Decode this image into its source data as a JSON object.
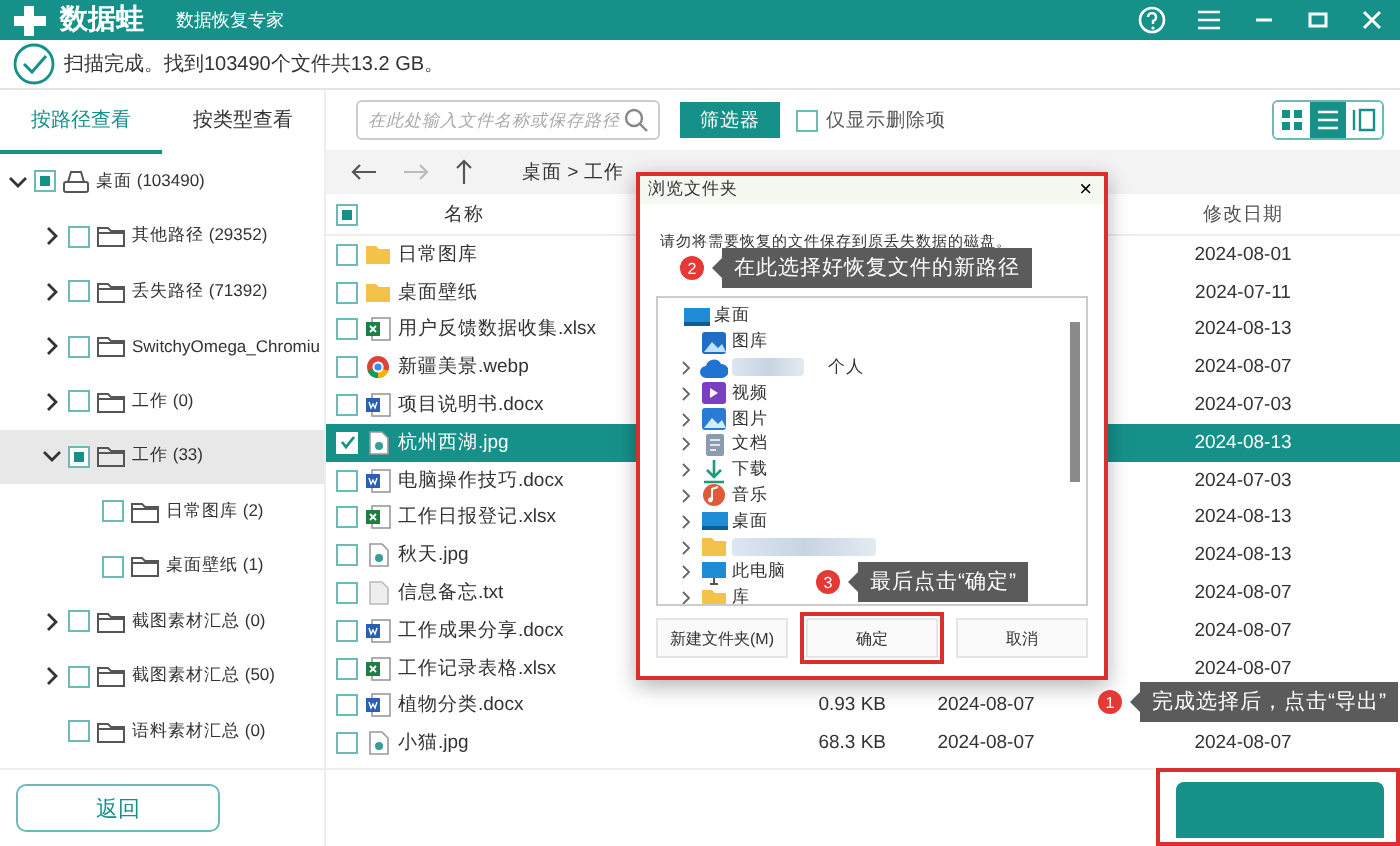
{
  "app": {
    "name": "数据蛙",
    "subtitle": "数据恢复专家"
  },
  "status": "扫描完成。找到103490个文件共13.2 GB。",
  "tabs": [
    {
      "label": "按路径查看",
      "selected": true
    },
    {
      "label": "按类型查看",
      "selected": false
    }
  ],
  "tree": [
    {
      "label": "桌面 (103490)",
      "expandable": true,
      "expanded": true,
      "partial": true,
      "selected": false,
      "kind": "drive",
      "children": [
        {
          "label": "其他路径 (29352)",
          "expandable": true,
          "expanded": false,
          "partial": false,
          "selected": false,
          "kind": "folder"
        },
        {
          "label": "丢失路径 (71392)",
          "expandable": true,
          "expanded": false,
          "partial": false,
          "selected": false,
          "kind": "folder"
        },
        {
          "label": "SwitchyOmega_Chromiu",
          "expandable": true,
          "expanded": false,
          "partial": false,
          "selected": false,
          "kind": "folder"
        },
        {
          "label": "工作 (0)",
          "expandable": true,
          "expanded": false,
          "partial": false,
          "selected": false,
          "kind": "folder"
        },
        {
          "label": "工作 (33)",
          "expandable": true,
          "expanded": true,
          "partial": true,
          "selected": true,
          "kind": "folder",
          "children": [
            {
              "label": "日常图库 (2)",
              "expandable": false,
              "partial": false,
              "selected": false,
              "kind": "folder"
            },
            {
              "label": "桌面壁纸 (1)",
              "expandable": false,
              "partial": false,
              "selected": false,
              "kind": "folder"
            }
          ]
        },
        {
          "label": "截图素材汇总 (0)",
          "expandable": true,
          "expanded": false,
          "partial": false,
          "selected": false,
          "kind": "folder"
        },
        {
          "label": "截图素材汇总 (50)",
          "expandable": true,
          "expanded": false,
          "partial": false,
          "selected": false,
          "kind": "folder"
        },
        {
          "label": "语料素材汇总 (0)",
          "expandable": false,
          "partial": false,
          "selected": false,
          "kind": "folder"
        }
      ]
    }
  ],
  "back_button": "返回",
  "search": {
    "placeholder": "在此处输入文件名称或保存路径"
  },
  "filter_button": "筛选器",
  "deleted_only": {
    "label": "仅显示删除项",
    "checked": false
  },
  "views": [
    {
      "kind": "grid",
      "selected": false
    },
    {
      "kind": "list",
      "selected": true
    },
    {
      "kind": "detail",
      "selected": false
    }
  ],
  "breadcrumb": "桌面 > 工作",
  "columns": {
    "name": "名称",
    "modified": "修改日期",
    "all_partial": true
  },
  "files": [
    {
      "name": "日常图库",
      "kind": "folder",
      "checked": false,
      "selected": false,
      "modified": "2024-08-01"
    },
    {
      "name": "桌面壁纸",
      "kind": "folder",
      "checked": false,
      "selected": false,
      "modified": "2024-07-11"
    },
    {
      "name": "用户反馈数据收集.xlsx",
      "kind": "xlsx",
      "checked": false,
      "selected": false,
      "modified": "2024-08-13"
    },
    {
      "name": "新疆美景.webp",
      "kind": "browser",
      "checked": false,
      "selected": false,
      "modified": "2024-08-07"
    },
    {
      "name": "项目说明书.docx",
      "kind": "docx",
      "checked": false,
      "selected": false,
      "modified": "2024-07-03"
    },
    {
      "name": "杭州西湖.jpg",
      "kind": "image",
      "checked": true,
      "selected": true,
      "modified": "2024-08-13"
    },
    {
      "name": "电脑操作技巧.docx",
      "kind": "docx",
      "checked": false,
      "selected": false,
      "modified": "2024-07-03"
    },
    {
      "name": "工作日报登记.xlsx",
      "kind": "xlsx",
      "checked": false,
      "selected": false,
      "modified": "2024-08-13"
    },
    {
      "name": "秋天.jpg",
      "kind": "image",
      "checked": false,
      "selected": false,
      "modified": "2024-08-13"
    },
    {
      "name": "信息备忘.txt",
      "kind": "txt",
      "checked": false,
      "selected": false,
      "modified": "2024-08-07"
    },
    {
      "name": "工作成果分享.docx",
      "kind": "docx",
      "checked": false,
      "selected": false,
      "modified": "2024-08-07"
    },
    {
      "name": "工作记录表格.xlsx",
      "kind": "xlsx",
      "checked": false,
      "selected": false,
      "modified": "2024-08-07"
    },
    {
      "name": "植物分类.docx",
      "kind": "docx",
      "checked": false,
      "selected": false,
      "size": "0.93 KB",
      "created": "2024-08-07"
    },
    {
      "name": "小猫.jpg",
      "kind": "image",
      "checked": false,
      "selected": false,
      "size": "68.3 KB",
      "created": "2024-08-07",
      "modified": "2024-08-07"
    }
  ],
  "dialog": {
    "title": "浏览文件夹",
    "close": "×",
    "message": "请勿将需要恢复的文件保存到原丢失数据的磁盘。",
    "folders": [
      {
        "kind": "desktop",
        "label": "桌面",
        "caret": false,
        "children": [
          {
            "kind": "gallery",
            "label": "图库",
            "caret": false
          },
          {
            "kind": "cloud",
            "label": "个人",
            "caret": true,
            "redacted": true
          },
          {
            "kind": "video",
            "label": "视频",
            "caret": true
          },
          {
            "kind": "pictures",
            "label": "图片",
            "caret": true
          },
          {
            "kind": "documents",
            "label": "文档",
            "caret": true
          },
          {
            "kind": "downloads",
            "label": "下载",
            "caret": true
          },
          {
            "kind": "music",
            "label": "音乐",
            "caret": true
          },
          {
            "kind": "desktop",
            "label": "桌面",
            "caret": true
          },
          {
            "kind": "folder",
            "caret": true,
            "redacted": true
          },
          {
            "kind": "pc",
            "label": "此电脑",
            "caret": true
          },
          {
            "kind": "folder",
            "label": "库",
            "caret": true
          }
        ]
      }
    ],
    "buttons": [
      {
        "label": "新建文件夹(M)",
        "highlighted": false
      },
      {
        "label": "确定",
        "highlighted": true
      },
      {
        "label": "取消",
        "highlighted": false
      }
    ]
  },
  "callouts": [
    {
      "number": "2",
      "text": "在此选择好恢复文件的新路径"
    },
    {
      "number": "3",
      "text": "最后点击“确定”"
    },
    {
      "number": "1",
      "text": "完成选择后，点击“导出”"
    }
  ]
}
